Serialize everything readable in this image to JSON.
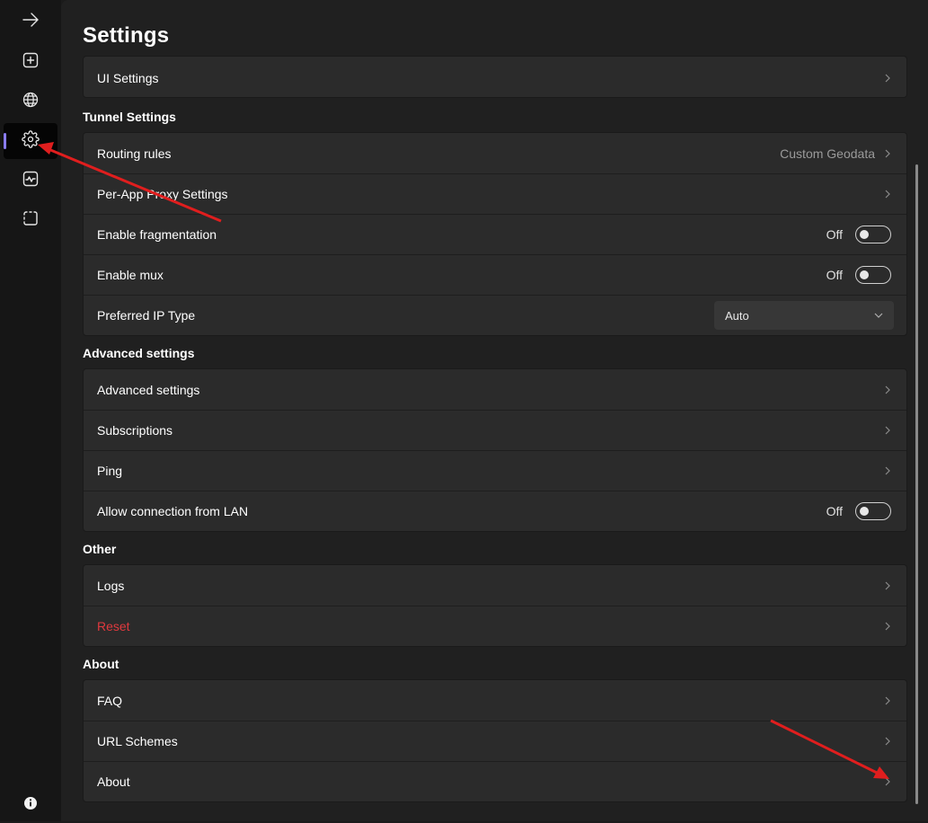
{
  "page_title": "Settings",
  "colors": {
    "accent": "#8a7cf7",
    "danger": "#e0393e",
    "annotation": "#e01e1e"
  },
  "sidebar": {
    "items": [
      {
        "icon": "arrow-right-icon",
        "active": false
      },
      {
        "icon": "add-icon",
        "active": false
      },
      {
        "icon": "globe-icon",
        "active": false
      },
      {
        "icon": "gear-icon",
        "active": true
      },
      {
        "icon": "activity-chart-icon",
        "active": false
      },
      {
        "icon": "dashed-square-icon",
        "active": false
      }
    ],
    "footer_icon": "info-icon"
  },
  "sections": {
    "ui": {
      "rows": [
        {
          "label": "UI Settings"
        }
      ]
    },
    "tunnel": {
      "title": "Tunnel Settings",
      "rows": [
        {
          "label": "Routing rules",
          "value": "Custom Geodata"
        },
        {
          "label": "Per-App Proxy Settings"
        },
        {
          "label": "Enable fragmentation",
          "state": "Off"
        },
        {
          "label": "Enable mux",
          "state": "Off"
        },
        {
          "label": "Preferred IP Type",
          "select_value": "Auto"
        }
      ]
    },
    "advanced": {
      "title": "Advanced settings",
      "rows": [
        {
          "label": "Advanced settings"
        },
        {
          "label": "Subscriptions"
        },
        {
          "label": "Ping"
        },
        {
          "label": "Allow connection from LAN",
          "state": "Off"
        }
      ]
    },
    "other": {
      "title": "Other",
      "rows": [
        {
          "label": "Logs"
        },
        {
          "label": "Reset"
        }
      ]
    },
    "about": {
      "title": "About",
      "rows": [
        {
          "label": "FAQ"
        },
        {
          "label": "URL Schemes"
        },
        {
          "label": "About"
        }
      ]
    }
  }
}
